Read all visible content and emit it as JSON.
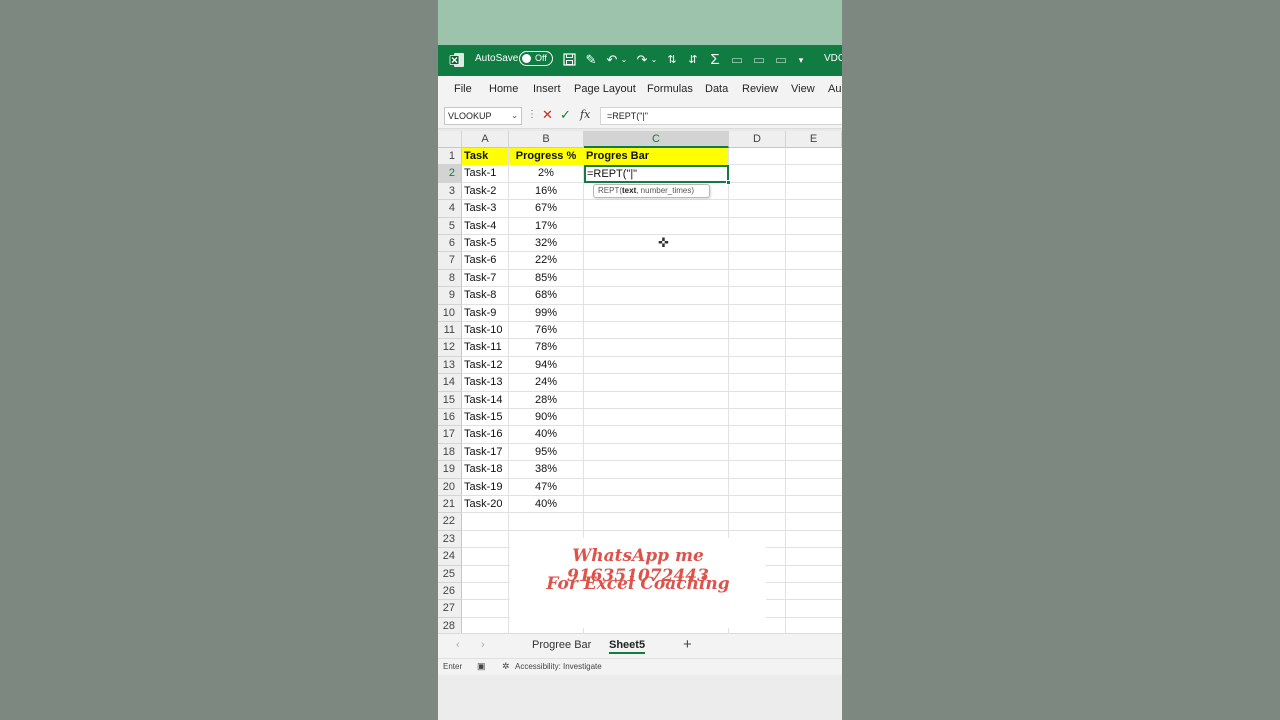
{
  "titlebar": {
    "autosave_label": "AutoSave",
    "autosave_state": "Off",
    "user_short": "VDO"
  },
  "ribbon_tabs": [
    "File",
    "Home",
    "Insert",
    "Page Layout",
    "Formulas",
    "Data",
    "Review",
    "View",
    "Au"
  ],
  "formula_bar": {
    "name_box": "VLOOKUP",
    "fx": "fx",
    "formula": "=REPT(\"|\""
  },
  "columns": [
    "A",
    "B",
    "C",
    "D",
    "E"
  ],
  "active_column": "C",
  "active_row": "2",
  "rows": [
    "1",
    "2",
    "3",
    "4",
    "5",
    "6",
    "7",
    "8",
    "9",
    "10",
    "11",
    "12",
    "13",
    "14",
    "15",
    "16",
    "17",
    "18",
    "19",
    "20",
    "21",
    "22",
    "23",
    "24",
    "25",
    "26",
    "27",
    "28"
  ],
  "headers": {
    "task": "Task",
    "progress": "Progress %",
    "bar": "Progres Bar"
  },
  "tasks": [
    {
      "name": "Task-1",
      "progress": "2%"
    },
    {
      "name": "Task-2",
      "progress": "16%"
    },
    {
      "name": "Task-3",
      "progress": "67%"
    },
    {
      "name": "Task-4",
      "progress": "17%"
    },
    {
      "name": "Task-5",
      "progress": "32%"
    },
    {
      "name": "Task-6",
      "progress": "22%"
    },
    {
      "name": "Task-7",
      "progress": "85%"
    },
    {
      "name": "Task-8",
      "progress": "68%"
    },
    {
      "name": "Task-9",
      "progress": "99%"
    },
    {
      "name": "Task-10",
      "progress": "76%"
    },
    {
      "name": "Task-11",
      "progress": "78%"
    },
    {
      "name": "Task-12",
      "progress": "94%"
    },
    {
      "name": "Task-13",
      "progress": "24%"
    },
    {
      "name": "Task-14",
      "progress": "28%"
    },
    {
      "name": "Task-15",
      "progress": "90%"
    },
    {
      "name": "Task-16",
      "progress": "40%"
    },
    {
      "name": "Task-17",
      "progress": "95%"
    },
    {
      "name": "Task-18",
      "progress": "38%"
    },
    {
      "name": "Task-19",
      "progress": "47%"
    },
    {
      "name": "Task-20",
      "progress": "40%"
    }
  ],
  "active_cell_text": "=REPT(\"|\"",
  "tooltip": {
    "fn": "REPT(",
    "arg_bold": "text",
    "rest": ", number_times)"
  },
  "watermark": {
    "line1": "WhatsApp me 916351072443",
    "line2": "For Excel Coaching"
  },
  "sheets": {
    "tab1": "Progree Bar",
    "tab2": "Sheet5",
    "add": "+"
  },
  "status": {
    "mode": "Enter",
    "accessibility": "Accessibility: Investigate"
  },
  "colors": {
    "excel_green": "#107c41",
    "header_fill": "#ffff00",
    "watermark_red": "#de524a"
  }
}
